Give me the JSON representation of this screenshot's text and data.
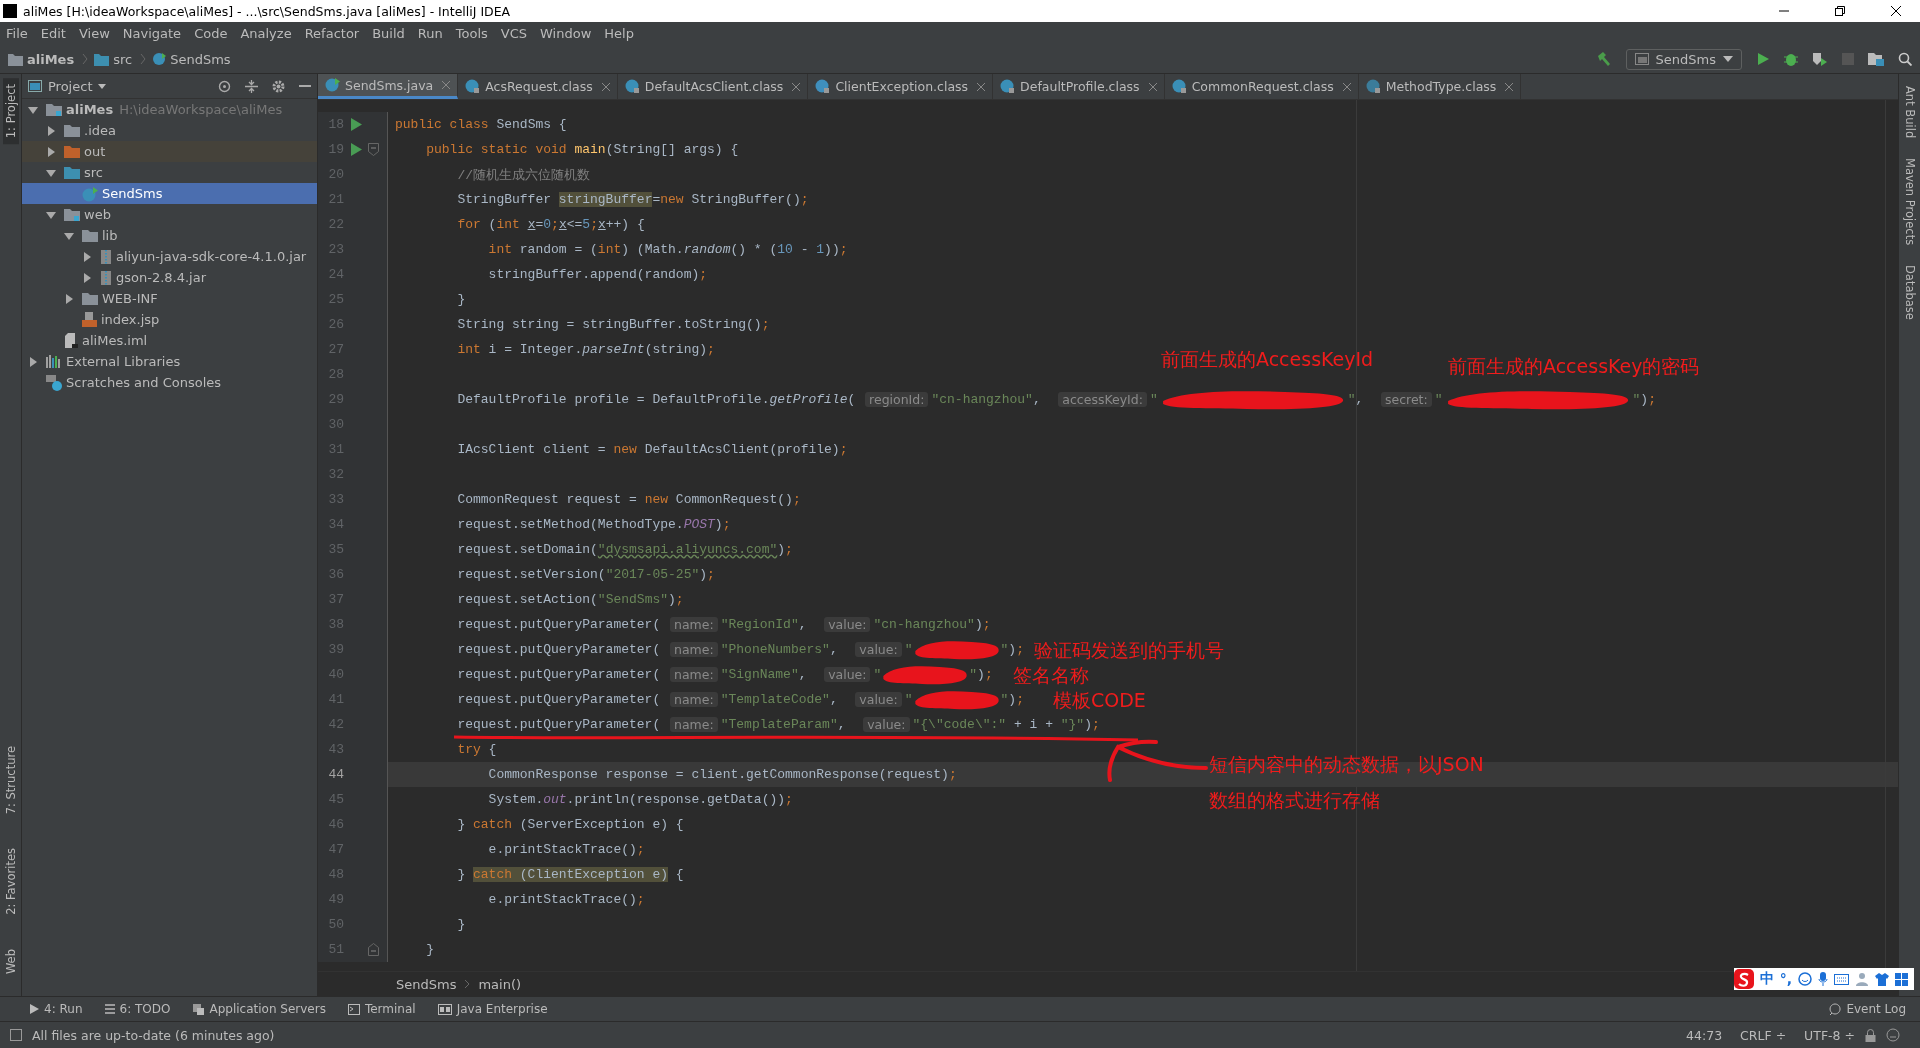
{
  "window": {
    "title": "aliMes [H:\\ideaWorkspace\\aliMes] - ...\\src\\SendSms.java [aliMes] - IntelliJ IDEA"
  },
  "menu": [
    "File",
    "Edit",
    "View",
    "Navigate",
    "Code",
    "Analyze",
    "Refactor",
    "Build",
    "Run",
    "Tools",
    "VCS",
    "Window",
    "Help"
  ],
  "nav_path": [
    {
      "label": "aliMes",
      "kind": "module"
    },
    {
      "label": "src",
      "kind": "folder"
    },
    {
      "label": "SendSms",
      "kind": "class"
    }
  ],
  "run_config": {
    "label": "SendSms"
  },
  "left_strip": [
    {
      "label": "1: Project",
      "selected": true
    },
    {
      "label": "7: Structure",
      "selected": false
    },
    {
      "label": "2: Favorites",
      "selected": false
    },
    {
      "label": "Web",
      "selected": false
    }
  ],
  "right_strip": [
    "Ant Build",
    "Maven Projects",
    "Database"
  ],
  "project_panel": {
    "title": "Project",
    "tree": [
      {
        "label": "aliMes",
        "hint": "H:\\ideaWorkspace\\aliMes",
        "kind": "module",
        "expanded": true,
        "selected": false,
        "children": [
          {
            "label": ".idea",
            "kind": "folder",
            "expanded": false,
            "selected": false
          },
          {
            "label": "out",
            "kind": "excluded",
            "expanded": false,
            "selected": false
          },
          {
            "label": "src",
            "kind": "source",
            "expanded": true,
            "selected": false,
            "children": [
              {
                "label": "SendSms",
                "kind": "class",
                "selected": true
              }
            ]
          },
          {
            "label": "web",
            "kind": "web",
            "expanded": true,
            "selected": false,
            "children": [
              {
                "label": "lib",
                "kind": "folder",
                "expanded": true,
                "selected": false,
                "children": [
                  {
                    "label": "aliyun-java-sdk-core-4.1.0.jar",
                    "kind": "jar",
                    "expanded": false,
                    "selected": false
                  },
                  {
                    "label": "gson-2.8.4.jar",
                    "kind": "jar",
                    "expanded": false,
                    "selected": false
                  }
                ]
              },
              {
                "label": "WEB-INF",
                "kind": "folder",
                "expanded": false,
                "selected": false
              },
              {
                "label": "index.jsp",
                "kind": "jsp",
                "selected": false
              }
            ]
          },
          {
            "label": "aliMes.iml",
            "kind": "iml",
            "selected": false
          }
        ]
      },
      {
        "label": "External Libraries",
        "kind": "libraries",
        "expanded": false,
        "selected": false
      },
      {
        "label": "Scratches and Consoles",
        "kind": "scratches",
        "selected": false
      }
    ]
  },
  "tabs": [
    {
      "label": "SendSms.java",
      "kind": "source",
      "selected": true
    },
    {
      "label": "AcsRequest.class",
      "kind": "class",
      "selected": false
    },
    {
      "label": "DefaultAcsClient.class",
      "kind": "class",
      "selected": false
    },
    {
      "label": "ClientException.class",
      "kind": "exception",
      "selected": false
    },
    {
      "label": "DefaultProfile.class",
      "kind": "class",
      "selected": false
    },
    {
      "label": "CommonRequest.class",
      "kind": "class",
      "selected": false
    },
    {
      "label": "MethodType.class",
      "kind": "enum",
      "selected": false
    }
  ],
  "code": [
    {
      "n": "18",
      "run": true,
      "current": false,
      "tokens": [
        {
          "kind": "keyword",
          "text": "public class "
        },
        {
          "kind": "plain",
          "text": "SendSms {"
        }
      ]
    },
    {
      "n": "19",
      "run": true,
      "fold": true,
      "current": false,
      "tokens": [
        {
          "kind": "keyword",
          "text": "public static void "
        },
        {
          "kind": "method",
          "text": "main"
        },
        {
          "kind": "plain",
          "text": "(String[] args) {"
        }
      ]
    },
    {
      "n": "20",
      "run": false,
      "current": false,
      "tokens": [
        {
          "kind": "comment",
          "text": "//随机生成六位随机数"
        }
      ]
    },
    {
      "n": "21",
      "run": false,
      "current": false,
      "tokens": [
        {
          "kind": "plain",
          "text": "StringBuffer "
        },
        {
          "kind": "plain-marked",
          "text": "stringBuffer"
        },
        {
          "kind": "plain",
          "text": "="
        },
        {
          "kind": "keyword",
          "text": "new "
        },
        {
          "kind": "plain",
          "text": "StringBuffer()"
        },
        {
          "kind": "keyword",
          "text": ";"
        }
      ]
    },
    {
      "n": "22",
      "run": false,
      "current": false,
      "tokens": [
        {
          "kind": "keyword",
          "text": "for "
        },
        {
          "kind": "plain",
          "text": "("
        },
        {
          "kind": "keyword",
          "text": "int "
        },
        {
          "kind": "variable",
          "text": "x"
        },
        {
          "kind": "plain",
          "text": "="
        },
        {
          "kind": "number",
          "text": "0"
        },
        {
          "kind": "keyword",
          "text": ";"
        },
        {
          "kind": "variable",
          "text": "x"
        },
        {
          "kind": "plain",
          "text": "<="
        },
        {
          "kind": "number",
          "text": "5"
        },
        {
          "kind": "keyword",
          "text": ";"
        },
        {
          "kind": "variable",
          "text": "x"
        },
        {
          "kind": "plain",
          "text": "++) {"
        }
      ]
    },
    {
      "n": "23",
      "run": false,
      "current": false,
      "tokens": [
        {
          "kind": "keyword",
          "text": "int "
        },
        {
          "kind": "plain",
          "text": "random = ("
        },
        {
          "kind": "keyword",
          "text": "int"
        },
        {
          "kind": "plain",
          "text": ") (Math."
        },
        {
          "kind": "static",
          "text": "random"
        },
        {
          "kind": "plain",
          "text": "() * ("
        },
        {
          "kind": "number",
          "text": "10"
        },
        {
          "kind": "plain",
          "text": " - "
        },
        {
          "kind": "number",
          "text": "1"
        },
        {
          "kind": "plain",
          "text": "))"
        },
        {
          "kind": "keyword",
          "text": ";"
        }
      ]
    },
    {
      "n": "24",
      "run": false,
      "current": false,
      "tokens": [
        {
          "kind": "plain",
          "text": "stringBuffer.append(random)"
        },
        {
          "kind": "keyword",
          "text": ";"
        }
      ]
    },
    {
      "n": "25",
      "run": false,
      "current": false,
      "tokens": [
        {
          "kind": "plain",
          "text": "}"
        }
      ]
    },
    {
      "n": "26",
      "run": false,
      "current": false,
      "tokens": [
        {
          "kind": "plain",
          "text": "String string = stringBuffer.toString()"
        },
        {
          "kind": "keyword",
          "text": ";"
        }
      ]
    },
    {
      "n": "27",
      "run": false,
      "current": false,
      "tokens": [
        {
          "kind": "keyword",
          "text": "int "
        },
        {
          "kind": "plain",
          "text": "i = Integer."
        },
        {
          "kind": "static",
          "text": "parseInt"
        },
        {
          "kind": "plain",
          "text": "(string)"
        },
        {
          "kind": "keyword",
          "text": ";"
        }
      ]
    },
    {
      "n": "28",
      "run": false,
      "current": false
    },
    {
      "n": "29",
      "run": false,
      "current": false,
      "tokens": [
        {
          "kind": "plain",
          "text": "DefaultProfile profile = DefaultProfile."
        },
        {
          "kind": "static",
          "text": "getProfile"
        },
        {
          "kind": "plain",
          "text": "( "
        },
        {
          "kind": "hint",
          "text": "regionId:"
        },
        {
          "kind": "string",
          "text": "\"cn-hangzhou\""
        },
        {
          "kind": "plain",
          "text": ",  "
        },
        {
          "kind": "hint",
          "text": "accessKeyId:"
        },
        {
          "kind": "string",
          "text": "\""
        },
        {
          "kind": "redacted"
        },
        {
          "kind": "string",
          "text": "\""
        },
        {
          "kind": "plain",
          "text": ",  "
        },
        {
          "kind": "hint",
          "text": "secret:"
        },
        {
          "kind": "string",
          "text": "\""
        },
        {
          "kind": "redacted"
        },
        {
          "kind": "string",
          "text": "\""
        },
        {
          "kind": "plain",
          "text": ")"
        },
        {
          "kind": "keyword",
          "text": ";"
        }
      ]
    },
    {
      "n": "30",
      "run": false,
      "current": false
    },
    {
      "n": "31",
      "run": false,
      "current": false,
      "tokens": [
        {
          "kind": "plain",
          "text": "IAcsClient client = "
        },
        {
          "kind": "keyword",
          "text": "new "
        },
        {
          "kind": "plain",
          "text": "DefaultAcsClient(profile)"
        },
        {
          "kind": "keyword",
          "text": ";"
        }
      ]
    },
    {
      "n": "32",
      "run": false,
      "current": false
    },
    {
      "n": "33",
      "run": false,
      "current": false,
      "tokens": [
        {
          "kind": "plain",
          "text": "CommonRequest request = "
        },
        {
          "kind": "keyword",
          "text": "new "
        },
        {
          "kind": "plain",
          "text": "CommonRequest()"
        },
        {
          "kind": "keyword",
          "text": ";"
        }
      ]
    },
    {
      "n": "34",
      "run": false,
      "current": false,
      "tokens": [
        {
          "kind": "plain",
          "text": "request.setMethod(MethodType."
        },
        {
          "kind": "field",
          "text": "POST"
        },
        {
          "kind": "plain",
          "text": ")"
        },
        {
          "kind": "keyword",
          "text": ";"
        }
      ]
    },
    {
      "n": "35",
      "run": false,
      "current": false,
      "tokens": [
        {
          "kind": "plain",
          "text": "request.setDomain("
        },
        {
          "kind": "url",
          "text": "\"dysmsapi.aliyuncs.com\""
        },
        {
          "kind": "plain",
          "text": ")"
        },
        {
          "kind": "keyword",
          "text": ";"
        }
      ]
    },
    {
      "n": "36",
      "run": false,
      "current": false,
      "tokens": [
        {
          "kind": "plain",
          "text": "request.setVersion("
        },
        {
          "kind": "string",
          "text": "\"2017-05-25\""
        },
        {
          "kind": "plain",
          "text": ")"
        },
        {
          "kind": "keyword",
          "text": ";"
        }
      ]
    },
    {
      "n": "37",
      "run": false,
      "current": false,
      "tokens": [
        {
          "kind": "plain",
          "text": "request.setAction("
        },
        {
          "kind": "string",
          "text": "\"SendSms\""
        },
        {
          "kind": "plain",
          "text": ")"
        },
        {
          "kind": "keyword",
          "text": ";"
        }
      ]
    },
    {
      "n": "38",
      "run": false,
      "current": false,
      "tokens": [
        {
          "kind": "plain",
          "text": "request.putQueryParameter( "
        },
        {
          "kind": "hint",
          "text": "name:"
        },
        {
          "kind": "string",
          "text": "\"RegionId\""
        },
        {
          "kind": "plain",
          "text": ",  "
        },
        {
          "kind": "hint",
          "text": "value:"
        },
        {
          "kind": "string",
          "text": "\"cn-hangzhou\""
        },
        {
          "kind": "plain",
          "text": ")"
        },
        {
          "kind": "keyword",
          "text": ";"
        }
      ]
    },
    {
      "n": "39",
      "run": false,
      "current": false,
      "tokens": [
        {
          "kind": "plain",
          "text": "request.putQueryParameter( "
        },
        {
          "kind": "hint",
          "text": "name:"
        },
        {
          "kind": "string",
          "text": "\"PhoneNumbers\""
        },
        {
          "kind": "plain",
          "text": ",  "
        },
        {
          "kind": "hint",
          "text": "value:"
        },
        {
          "kind": "string",
          "text": "\""
        },
        {
          "kind": "redacted"
        },
        {
          "kind": "string",
          "text": "\""
        },
        {
          "kind": "plain",
          "text": ")"
        },
        {
          "kind": "keyword",
          "text": ";"
        }
      ]
    },
    {
      "n": "40",
      "run": false,
      "current": false,
      "tokens": [
        {
          "kind": "plain",
          "text": "request.putQueryParameter( "
        },
        {
          "kind": "hint",
          "text": "name:"
        },
        {
          "kind": "string",
          "text": "\"SignName\""
        },
        {
          "kind": "plain",
          "text": ",  "
        },
        {
          "kind": "hint",
          "text": "value:"
        },
        {
          "kind": "string",
          "text": "\""
        },
        {
          "kind": "redacted"
        },
        {
          "kind": "string",
          "text": "\""
        },
        {
          "kind": "plain",
          "text": ")"
        },
        {
          "kind": "keyword",
          "text": ";"
        }
      ]
    },
    {
      "n": "41",
      "run": false,
      "current": false,
      "tokens": [
        {
          "kind": "plain",
          "text": "request.putQueryParameter( "
        },
        {
          "kind": "hint",
          "text": "name:"
        },
        {
          "kind": "string",
          "text": "\"TemplateCode\""
        },
        {
          "kind": "plain",
          "text": ",  "
        },
        {
          "kind": "hint",
          "text": "value:"
        },
        {
          "kind": "string",
          "text": "\""
        },
        {
          "kind": "redacted"
        },
        {
          "kind": "string",
          "text": "\""
        },
        {
          "kind": "plain",
          "text": ")"
        },
        {
          "kind": "keyword",
          "text": ";"
        }
      ]
    },
    {
      "n": "42",
      "run": false,
      "current": false,
      "tokens": [
        {
          "kind": "plain",
          "text": "request.putQueryParameter( "
        },
        {
          "kind": "hint",
          "text": "name:"
        },
        {
          "kind": "string",
          "text": "\"TemplateParam\""
        },
        {
          "kind": "plain",
          "text": ",  "
        },
        {
          "kind": "hint",
          "text": "value:"
        },
        {
          "kind": "string",
          "text": "\"{\\\"code\\\":\""
        },
        {
          "kind": "plain",
          "text": " + i + "
        },
        {
          "kind": "string",
          "text": "\"}\""
        },
        {
          "kind": "plain",
          "text": ")"
        },
        {
          "kind": "keyword",
          "text": ";"
        }
      ]
    },
    {
      "n": "43",
      "run": false,
      "current": false,
      "tokens": [
        {
          "kind": "keyword",
          "text": "try "
        },
        {
          "kind": "plain",
          "text": "{"
        }
      ]
    },
    {
      "n": "44",
      "run": false,
      "current": true,
      "tokens": [
        {
          "kind": "plain",
          "text": "CommonResponse response = client.getCommonResponse(request)"
        },
        {
          "kind": "keyword",
          "text": ";"
        }
      ]
    },
    {
      "n": "45",
      "run": false,
      "current": false,
      "tokens": [
        {
          "kind": "plain",
          "text": "System."
        },
        {
          "kind": "field",
          "text": "out"
        },
        {
          "kind": "plain",
          "text": ".println(response.getData())"
        },
        {
          "kind": "keyword",
          "text": ";"
        }
      ]
    },
    {
      "n": "46",
      "run": false,
      "current": false,
      "tokens": [
        {
          "kind": "plain",
          "text": "} "
        },
        {
          "kind": "keyword",
          "text": "catch "
        },
        {
          "kind": "plain",
          "text": "(ServerException e) {"
        }
      ]
    },
    {
      "n": "47",
      "run": false,
      "current": false,
      "tokens": [
        {
          "kind": "plain",
          "text": "e.printStackTrace()"
        },
        {
          "kind": "keyword",
          "text": ";"
        }
      ]
    },
    {
      "n": "48",
      "run": false,
      "current": false,
      "tokens": [
        {
          "kind": "plain",
          "text": "} "
        },
        {
          "kind": "keyword-marked",
          "text": "catch "
        },
        {
          "kind": "plain-marked",
          "text": "(ClientException e)"
        },
        {
          "kind": "plain",
          "text": " {"
        }
      ]
    },
    {
      "n": "49",
      "run": false,
      "current": false,
      "tokens": [
        {
          "kind": "plain",
          "text": "e.printStackTrace()"
        },
        {
          "kind": "keyword",
          "text": ";"
        }
      ]
    },
    {
      "n": "50",
      "run": false,
      "current": false,
      "tokens": [
        {
          "kind": "plain",
          "text": "}"
        }
      ]
    },
    {
      "n": "51",
      "run": false,
      "fold": true,
      "current": false,
      "tokens": [
        {
          "kind": "plain",
          "text": "}"
        }
      ]
    }
  ],
  "annotations": [
    "前面生成的AccessKeyId",
    "前面生成的AccessKey的密码",
    "验证码发送到的手机号",
    "签名名称",
    "模板CODE",
    "短信内容中的动态数据，以JSON",
    "数组的格式进行存储"
  ],
  "breadcrumb": [
    "SendSms",
    "main()"
  ],
  "tool_windows": [
    {
      "label": "4: Run",
      "kind": "run"
    },
    {
      "label": "6: TODO",
      "kind": "todo"
    },
    {
      "label": "Application Servers",
      "kind": "servers"
    },
    {
      "label": "Terminal",
      "kind": "terminal"
    },
    {
      "label": "Java Enterprise",
      "kind": "enterprise"
    }
  ],
  "event_log": "Event Log",
  "status": {
    "message": "All files are up-to-date (6 minutes ago)",
    "position": "44:73",
    "line_separator": "CRLF ÷",
    "encoding": "UTF-8 ÷"
  },
  "ime": {
    "language": "中",
    "punctuation": "°,"
  }
}
